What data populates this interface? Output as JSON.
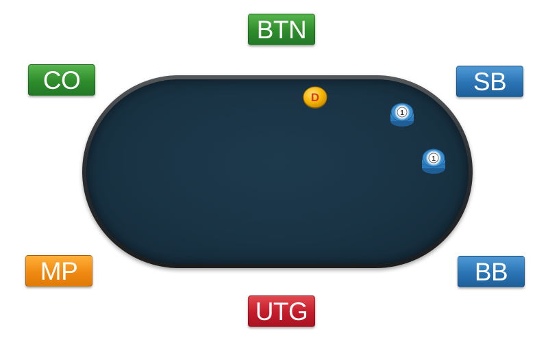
{
  "positions": {
    "btn": "BTN",
    "co": "CO",
    "sb": "SB",
    "mp": "MP",
    "bb": "BB",
    "utg": "UTG"
  },
  "dealer_button": {
    "label": "D"
  },
  "chips": {
    "sb": "1",
    "bb": "1"
  },
  "colors": {
    "felt": "#193344",
    "rail": "#2c2f31",
    "green": "#2e8c2b",
    "blue": "#2a74b5",
    "orange": "#f08a12",
    "red": "#c41c2b",
    "dealer": "#f5b400",
    "chip": "#3a8fd0"
  },
  "icons": {
    "dealer": "dealer-button-icon",
    "chip": "poker-chip-stack-icon"
  }
}
